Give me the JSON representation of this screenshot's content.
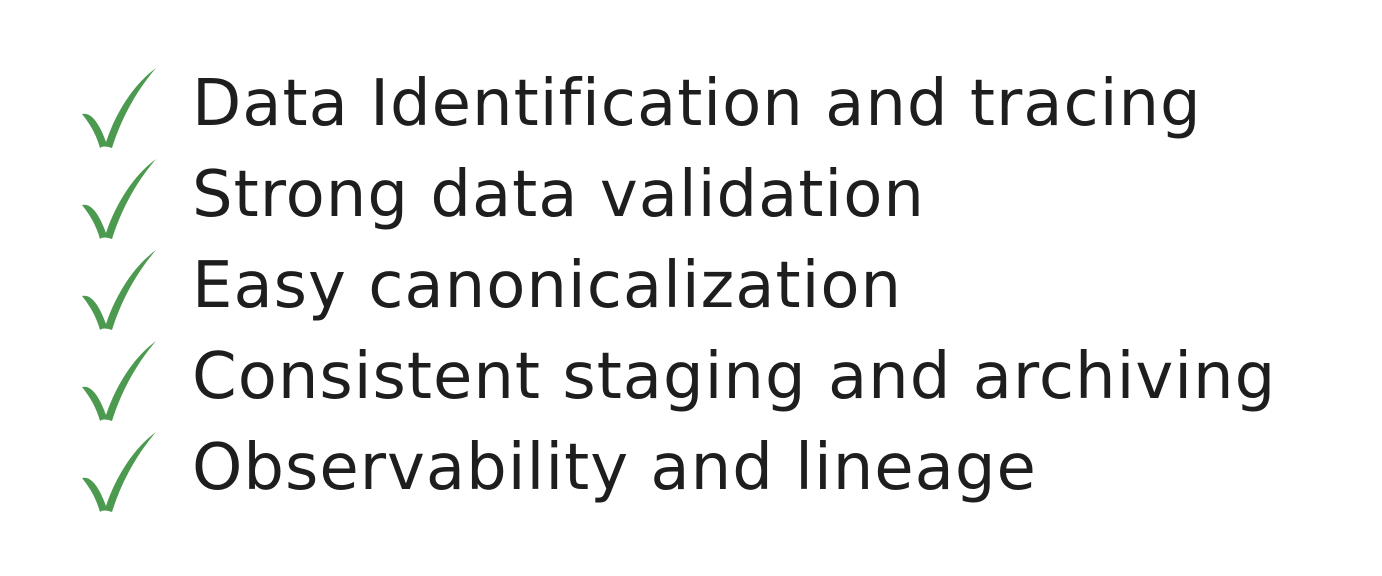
{
  "icons": {
    "check": "check-icon"
  },
  "colors": {
    "check": "#4c9a4f",
    "text": "#1e1e1e",
    "background": "#ffffff"
  },
  "items": [
    {
      "label": "Data Identification and tracing"
    },
    {
      "label": "Strong data validation"
    },
    {
      "label": "Easy canonicalization"
    },
    {
      "label": "Consistent staging and archiving"
    },
    {
      "label": "Observability and lineage"
    }
  ]
}
